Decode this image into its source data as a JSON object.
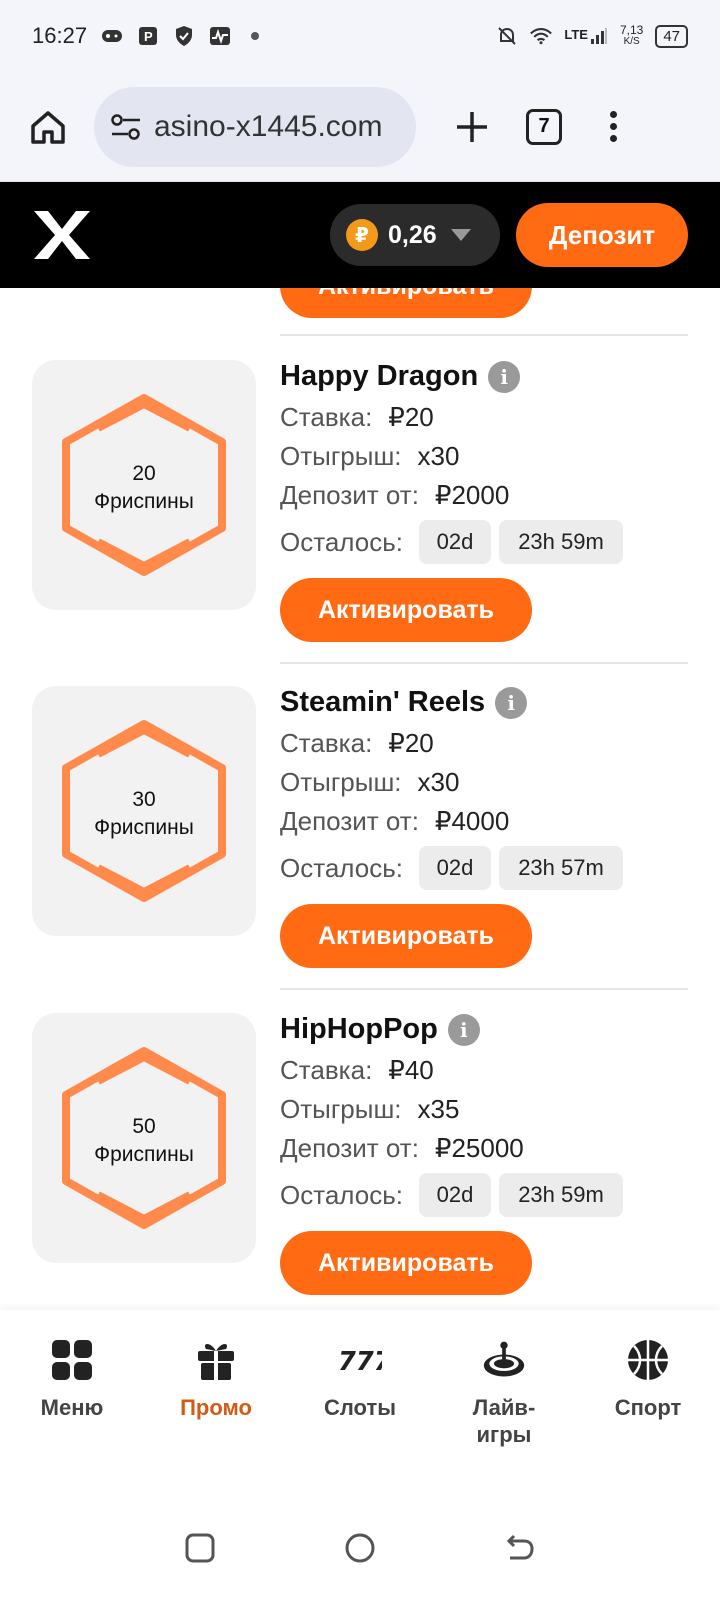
{
  "status_bar": {
    "time": "16:27",
    "network": "LTE",
    "speed_value": "7,13",
    "speed_unit": "K/S",
    "battery": "47"
  },
  "browser": {
    "url": "asino-x1445.com",
    "tab_count": "7"
  },
  "header": {
    "currency_symbol": "₽",
    "balance": "0,26",
    "deposit_label": "Депозит"
  },
  "labels": {
    "bet": "Ставка:",
    "wager": "Отыгрыш:",
    "deposit_from": "Депозит от:",
    "remaining": "Осталось:",
    "activate": "Активировать",
    "info": "i"
  },
  "promos": [
    {
      "spins": "20",
      "spins_label": "Фриспины",
      "title": "Happy Dragon",
      "bet": "₽20",
      "wager": "x30",
      "deposit_from": "₽2000",
      "days": "02d",
      "time": "23h 59m"
    },
    {
      "spins": "30",
      "spins_label": "Фриспины",
      "title": "Steamin' Reels",
      "bet": "₽20",
      "wager": "x30",
      "deposit_from": "₽4000",
      "days": "02d",
      "time": "23h 57m"
    },
    {
      "spins": "50",
      "spins_label": "Фриспины",
      "title": "HipHopPop",
      "bet": "₽40",
      "wager": "x35",
      "deposit_from": "₽25000",
      "days": "02d",
      "time": "23h 59m"
    }
  ],
  "nav": {
    "items": [
      {
        "label": "Меню",
        "icon": "grid-icon"
      },
      {
        "label": "Промо",
        "icon": "gift-icon"
      },
      {
        "label": "Слоты",
        "icon": "slots-777-icon"
      },
      {
        "label": "Лайв-\nигры",
        "icon": "roulette-icon"
      },
      {
        "label": "Спорт",
        "icon": "basketball-icon"
      }
    ],
    "active": "Промо"
  },
  "colors": {
    "accent": "#ff6a13",
    "hexagon": "#ff8a4c",
    "header_bg": "#000000",
    "active_nav": "#d35b14"
  }
}
